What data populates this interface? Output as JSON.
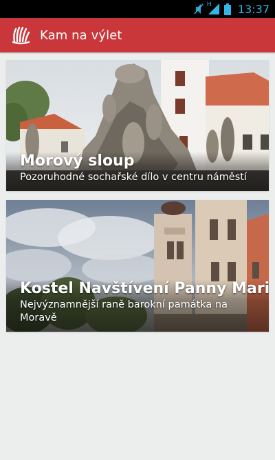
{
  "status_bar": {
    "time": "13:37",
    "network_type": "H",
    "icons": [
      "mute-icon",
      "signal-icon",
      "battery-icon"
    ],
    "accent": "#33b5e5"
  },
  "action_bar": {
    "title": "Kam na výlet",
    "icon": "app-logo-icon",
    "color": "#c9373a"
  },
  "cards": [
    {
      "title": "Morový sloup",
      "description": "Pozoruhodné sochařské dílo v centru náměstí"
    },
    {
      "title": "Kostel Navštívení Panny Marie",
      "description": "Nejvýznamnější raně barokní památka na Moravě"
    }
  ]
}
